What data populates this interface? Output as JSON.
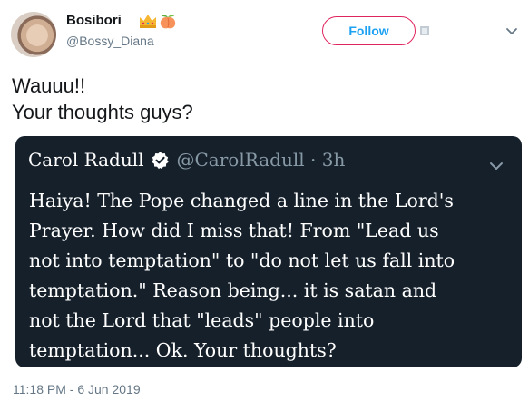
{
  "author": {
    "display_name": "Bosibori",
    "handle": "@Bossy_Diana",
    "name_emojis": [
      "crown-icon",
      "peach-icon"
    ]
  },
  "actions": {
    "follow_label": "Follow"
  },
  "tweet": {
    "lines": [
      "Wauuu!!",
      "Your thoughts guys?"
    ],
    "timestamp": "11:18 PM - 6 Jun 2019"
  },
  "quoted": {
    "name": "Carol Radull",
    "handle_time": "@CarolRadull · 3h",
    "lines": [
      "Haiya! The Pope changed a line in the Lord's",
      "Prayer. How did I miss that! From \"Lead us",
      "not into temptation\" to \"do not let us fall into",
      "temptation.\" Reason being... it is satan and",
      "not the Lord that \"leads\" people into",
      "temptation... Ok. Your thoughts?"
    ]
  },
  "colors": {
    "accent_blue": "#1da1f2",
    "follow_border": "#e0245e",
    "quote_bg": "#15202b",
    "muted_text": "#657786"
  }
}
